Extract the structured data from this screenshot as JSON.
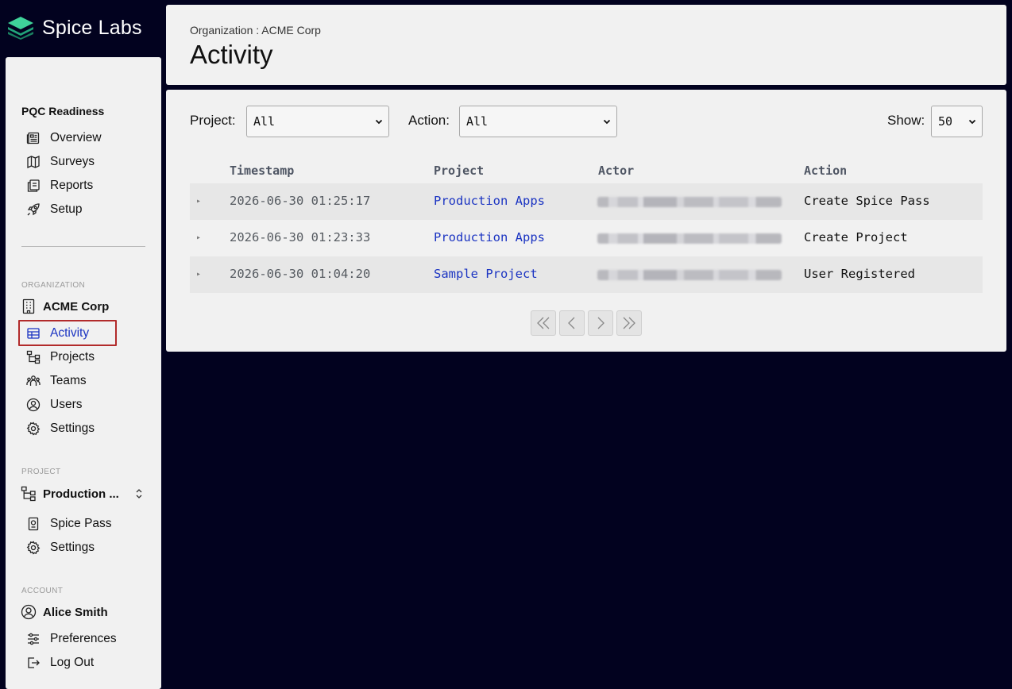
{
  "app": {
    "brand": "Spice Labs"
  },
  "sidebar": {
    "pqc_title": "PQC Readiness",
    "pqc_items": [
      {
        "label": "Overview",
        "icon": "newspaper-icon"
      },
      {
        "label": "Surveys",
        "icon": "map-icon"
      },
      {
        "label": "Reports",
        "icon": "reports-icon"
      },
      {
        "label": "Setup",
        "icon": "rocket-icon"
      }
    ],
    "org_label": "ORGANIZATION",
    "org_name": "ACME Corp",
    "org_items": [
      {
        "label": "Activity",
        "icon": "table-icon",
        "active": true
      },
      {
        "label": "Projects",
        "icon": "hierarchy-icon"
      },
      {
        "label": "Teams",
        "icon": "teams-icon"
      },
      {
        "label": "Users",
        "icon": "user-circle-icon"
      },
      {
        "label": "Settings",
        "icon": "gear-icon"
      }
    ],
    "project_label": "PROJECT",
    "project_name": "Production ...",
    "project_items": [
      {
        "label": "Spice Pass",
        "icon": "passport-icon"
      },
      {
        "label": "Settings",
        "icon": "gear-icon"
      }
    ],
    "account_label": "ACCOUNT",
    "account_name": "Alice Smith",
    "account_items": [
      {
        "label": "Preferences",
        "icon": "sliders-icon"
      },
      {
        "label": "Log Out",
        "icon": "logout-icon"
      }
    ]
  },
  "header": {
    "breadcrumb": "Organization : ACME Corp",
    "title": "Activity"
  },
  "filters": {
    "project_label": "Project:",
    "project_value": "All",
    "action_label": "Action:",
    "action_value": "All",
    "show_label": "Show:",
    "show_value": "50"
  },
  "table": {
    "columns": [
      "Timestamp",
      "Project",
      "Actor",
      "Action"
    ],
    "rows": [
      {
        "timestamp": "2026-06-30 01:25:17",
        "project": "Production Apps",
        "action": "Create Spice Pass"
      },
      {
        "timestamp": "2026-06-30 01:23:33",
        "project": "Production Apps",
        "action": "Create Project"
      },
      {
        "timestamp": "2026-06-30 01:04:20",
        "project": "Sample Project",
        "action": "User Registered"
      }
    ]
  },
  "pagination": {
    "buttons": [
      "first-page-icon",
      "prev-page-icon",
      "next-page-icon",
      "last-page-icon"
    ]
  },
  "colors": {
    "background": "#02021f",
    "panel": "#f1f1f1",
    "accent_link": "#1b34c2",
    "active_outline": "#b22b2b",
    "logo_green": "#2eb88a"
  }
}
